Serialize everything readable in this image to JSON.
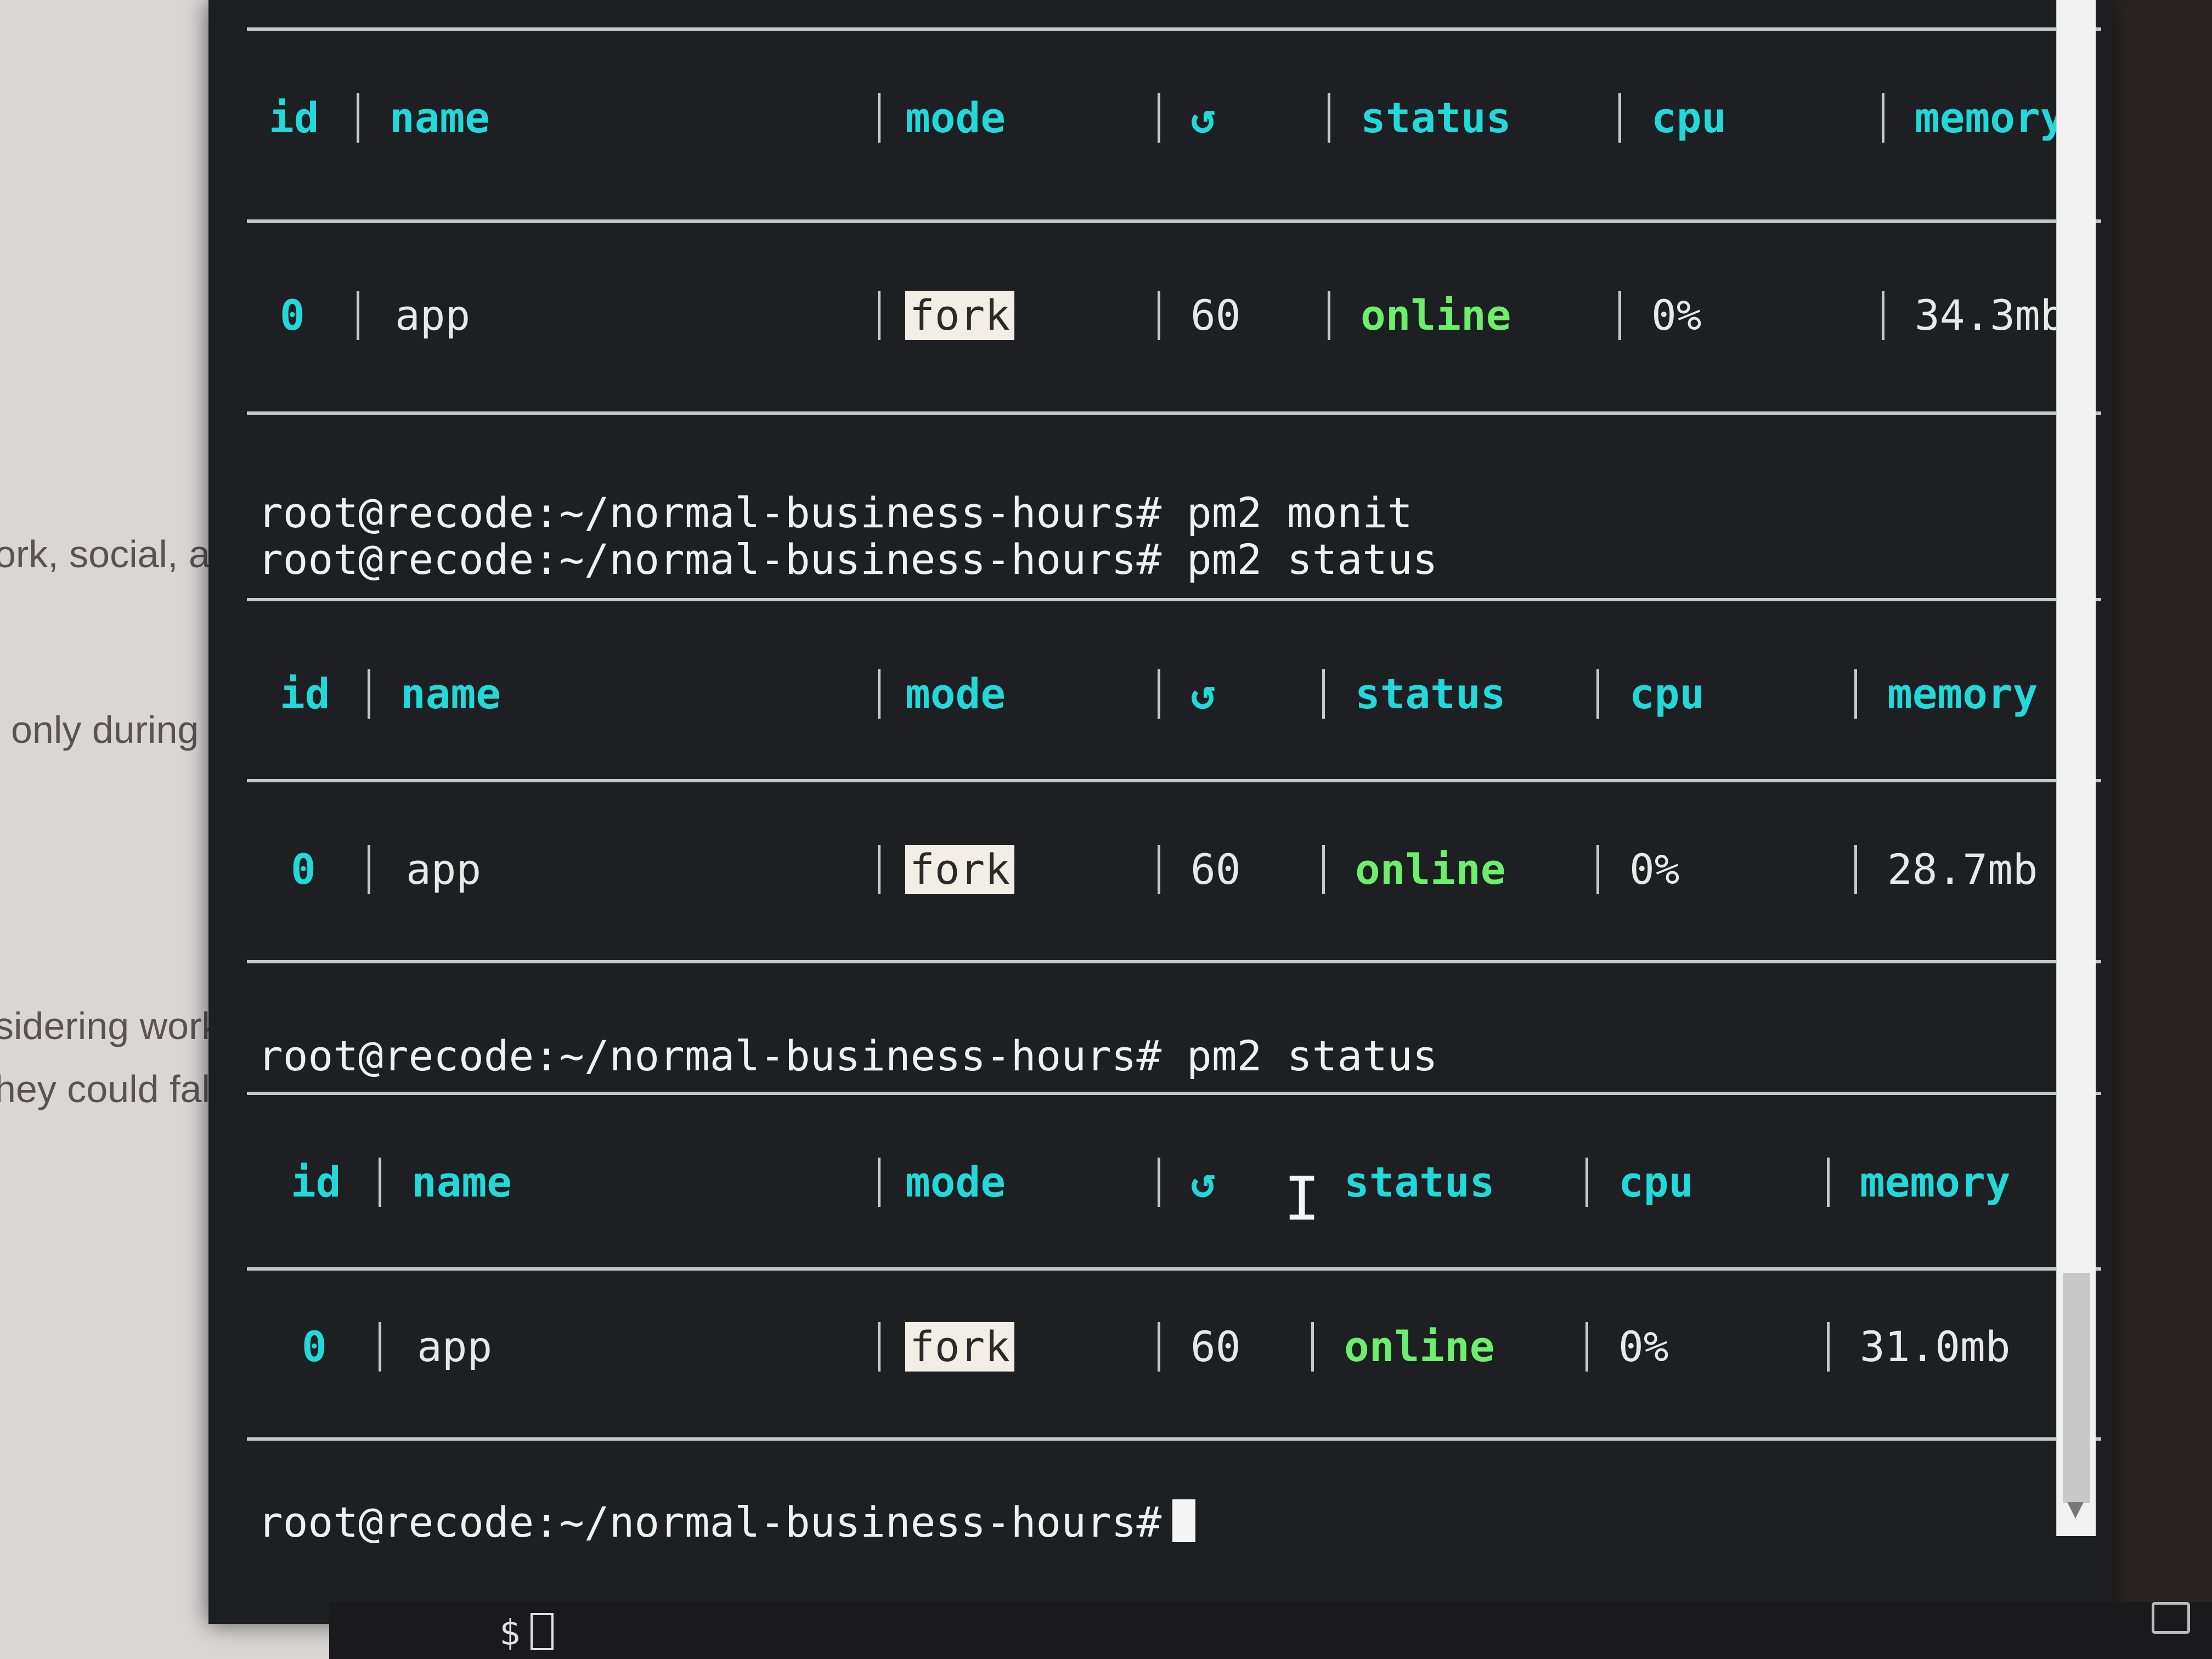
{
  "background_doc": {
    "lines": [
      "ork, social, a",
      "only during r",
      "sidering work, v",
      "hey could fall i"
    ]
  },
  "tables": [
    {
      "headers": {
        "id": "id",
        "name": "name",
        "mode": "mode",
        "restarts": "↺",
        "status": "status",
        "cpu": "cpu",
        "memory": "memory"
      },
      "row": {
        "id": "0",
        "name": "app",
        "mode": "fork",
        "restarts": "60",
        "status": "online",
        "cpu": "0%",
        "memory": "34.3mb"
      }
    },
    {
      "headers": {
        "id": "id",
        "name": "name",
        "mode": "mode",
        "restarts": "↺",
        "status": "status",
        "cpu": "cpu",
        "memory": "memory"
      },
      "row": {
        "id": "0",
        "name": "app",
        "mode": "fork",
        "restarts": "60",
        "status": "online",
        "cpu": "0%",
        "memory": "28.7mb"
      }
    },
    {
      "headers": {
        "id": "id",
        "name": "name",
        "mode": "mode",
        "restarts": "↺",
        "status": "status",
        "cpu": "cpu",
        "memory": "memory"
      },
      "row": {
        "id": "0",
        "name": "app",
        "mode": "fork",
        "restarts": "60",
        "status": "online",
        "cpu": "0%",
        "memory": "31.0mb"
      }
    }
  ],
  "prompts": [
    "root@recode:~/normal-business-hours# pm2 monit",
    "root@recode:~/normal-business-hours# pm2 status",
    "root@recode:~/normal-business-hours# pm2 status",
    "root@recode:~/normal-business-hours#"
  ],
  "bottom_shell": {
    "prompt": "$"
  },
  "icons": {
    "text_cursor": "text-cursor-ibeam-icon",
    "restart": "restart-icon",
    "window": "window-icon"
  },
  "colors": {
    "header": "#22d8d8",
    "status_online": "#6cf06c",
    "terminal_bg": "#1e1f22"
  }
}
